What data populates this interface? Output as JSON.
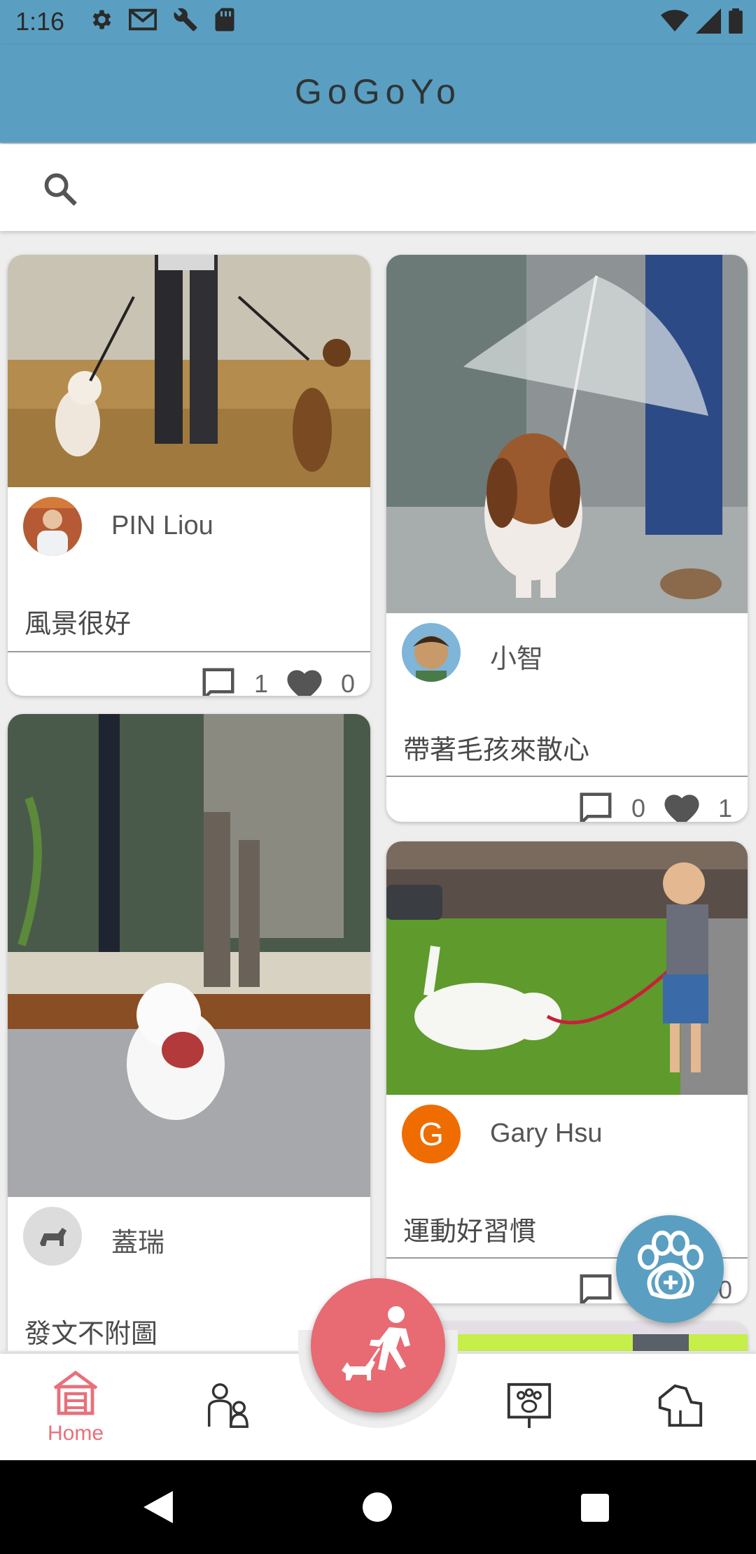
{
  "status_bar": {
    "time": "1:16",
    "left_icons": [
      "gear-icon",
      "gmail-icon",
      "wrench-icon",
      "sd-card-icon"
    ],
    "right_icons": [
      "wifi-icon",
      "signal-icon",
      "battery-icon"
    ]
  },
  "app_bar": {
    "title": "GoGoYo"
  },
  "search": {
    "placeholder": "",
    "value": ""
  },
  "feed": {
    "posts": [
      {
        "author": "PIN Liou",
        "caption": "風景很好",
        "comments": "1",
        "likes": "0",
        "photo": "two dogs walking on field"
      },
      {
        "author": "小智",
        "caption": "帶著毛孩來散心",
        "comments": "0",
        "likes": "1",
        "photo": "beagle under umbrella"
      },
      {
        "author": "蓋瑞",
        "caption": "發文不附圖",
        "photo": "white dog sitting by garden"
      },
      {
        "author": "Gary Hsu",
        "avatar_letter": "G",
        "caption": "運動好習慣",
        "comments": "0",
        "likes": "0",
        "photo": "child walking white terrier on grass"
      }
    ]
  },
  "bottom_nav": {
    "items": [
      {
        "label": "Home",
        "icon": "home-icon",
        "active": true
      },
      {
        "label": "",
        "icon": "people-with-dog-icon"
      },
      {
        "label": "",
        "icon": "walk-dog-fab-icon"
      },
      {
        "label": "",
        "icon": "paw-sign-icon"
      },
      {
        "label": "",
        "icon": "dog-head-icon"
      }
    ]
  },
  "fab": {
    "icon": "paw-add-icon"
  },
  "colors": {
    "primary": "#5a9fc1",
    "accent": "#e86a72",
    "avatar_g": "#ef6c00"
  }
}
